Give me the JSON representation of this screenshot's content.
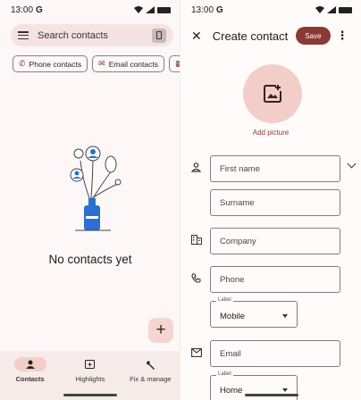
{
  "left": {
    "status": {
      "time": "13:00",
      "g": "G"
    },
    "search": {
      "placeholder": "Search contacts"
    },
    "chips": [
      {
        "label": "Phone contacts"
      },
      {
        "label": "Email contacts"
      }
    ],
    "empty_text": "No contacts yet",
    "fab_label": "+",
    "nav": [
      {
        "label": "Contacts"
      },
      {
        "label": "Highlights"
      },
      {
        "label": "Fix & manage"
      }
    ]
  },
  "right": {
    "status": {
      "time": "13:00",
      "g": "G"
    },
    "header": {
      "title": "Create contact",
      "save_label": "Save",
      "close_glyph": "✕",
      "more_glyph": "⋮"
    },
    "add_picture": "Add picture",
    "fields": {
      "first_name": "First name",
      "surname": "Surname",
      "company": "Company",
      "phone": "Phone",
      "phone_label_caption": "Label",
      "phone_label_value": "Mobile",
      "email": "Email",
      "email_label_caption": "Label",
      "email_label_value": "Home"
    }
  },
  "colors": {
    "accent": "#8a3a32",
    "chip_bg": "#f3cec8",
    "nav_bg": "#f6ebe9"
  }
}
